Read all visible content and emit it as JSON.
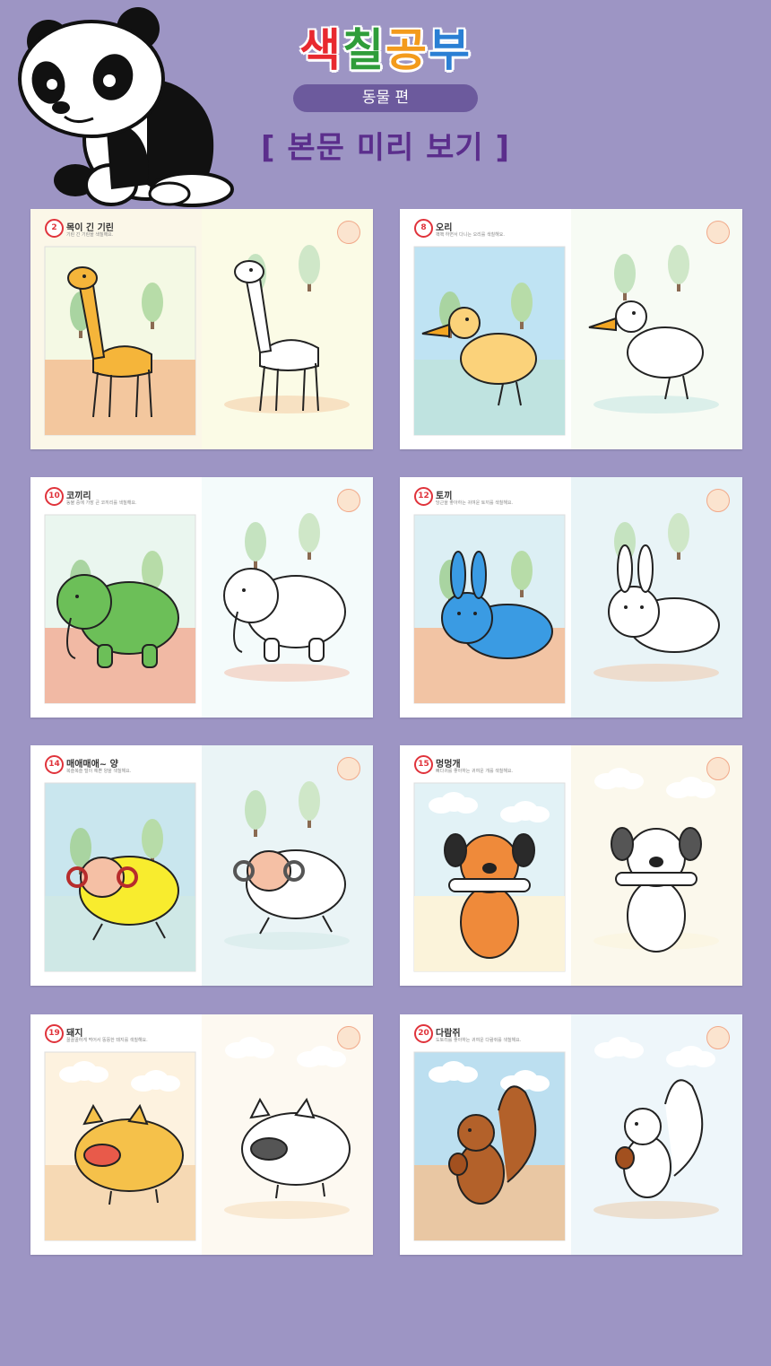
{
  "header": {
    "title_chars": [
      {
        "char": "색",
        "color": "#e8292f"
      },
      {
        "char": "칠",
        "color": "#2f9d3a"
      },
      {
        "char": "공",
        "color": "#f39b1c"
      },
      {
        "char": "부",
        "color": "#2a7fd4"
      }
    ],
    "subtitle": "동물 편",
    "preview_label": "[ 본문 미리 보기 ]"
  },
  "pages": [
    {
      "number": "2",
      "title": "목이 긴 기린",
      "subtitle": "기린 긴 기린을 색칠해요.",
      "animal": "giraffe"
    },
    {
      "number": "8",
      "title": "오리",
      "subtitle": "꽥꽥 하면서 다니는 오리를 색칠해요.",
      "animal": "duck"
    },
    {
      "number": "10",
      "title": "코끼리",
      "subtitle": "동물 중에 가장 큰 코끼리를 색칠해요.",
      "animal": "elephant"
    },
    {
      "number": "12",
      "title": "토끼",
      "subtitle": "당근을 좋아하는 귀여운 토끼를 색칠해요.",
      "animal": "rabbit"
    },
    {
      "number": "14",
      "title": "매애매애~ 양",
      "subtitle": "복슬복슬 털이 예쁜 양을 색칠해요.",
      "animal": "sheep"
    },
    {
      "number": "15",
      "title": "멍멍개",
      "subtitle": "뼈다귀를 좋아하는 귀여운 개를 색칠해요.",
      "animal": "dog"
    },
    {
      "number": "19",
      "title": "돼지",
      "subtitle": "꿀꿀꿀하게 먹어서 뚱뚱한 돼지를 색칠해요.",
      "animal": "pig"
    },
    {
      "number": "20",
      "title": "다람쥐",
      "subtitle": "도토리를 좋아하는 귀여운 다람쥐를 색칠해요.",
      "animal": "squirrel"
    }
  ]
}
